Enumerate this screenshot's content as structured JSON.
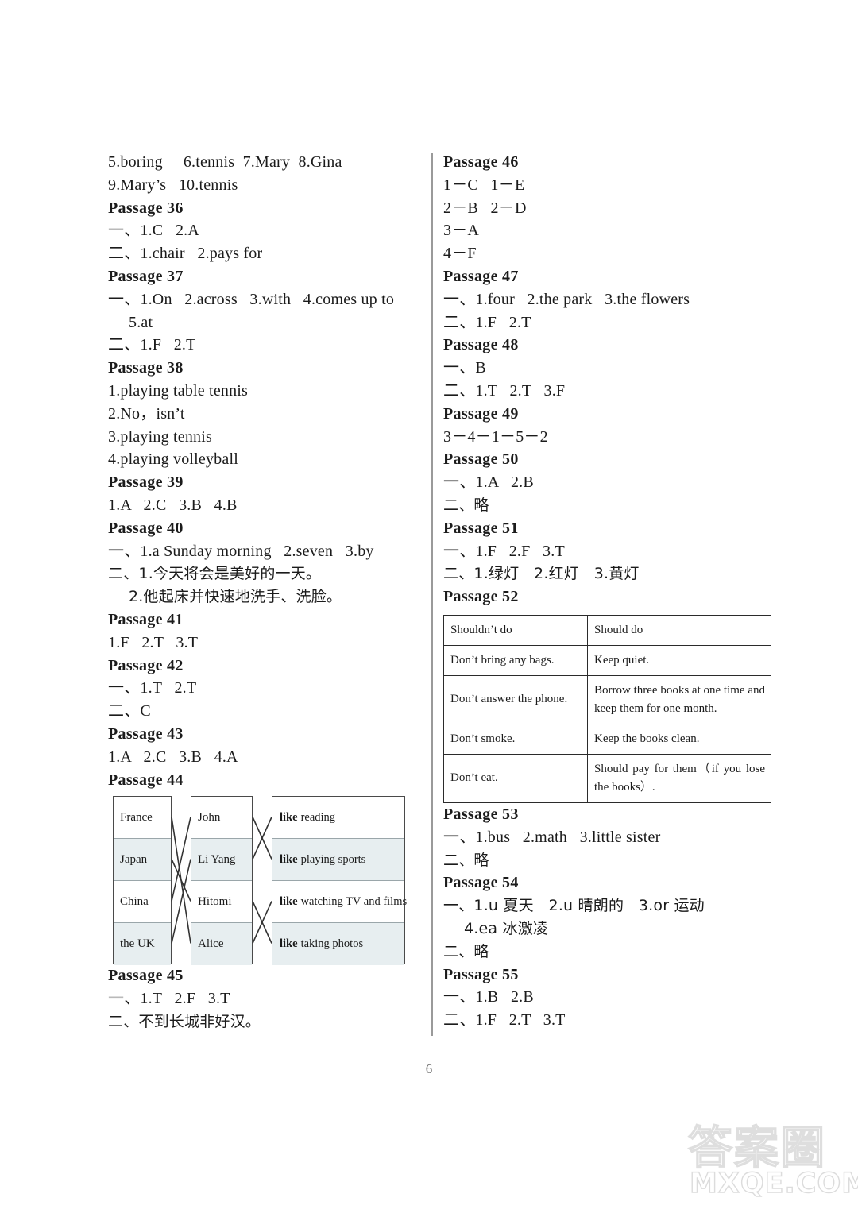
{
  "page": {
    "number": "6"
  },
  "watermark": {
    "cjk": "答案圈",
    "url": "MXQE.COM"
  },
  "left_column": {
    "continued_answers": {
      "line1": "5.boring     6.tennis  7.Mary  8.Gina",
      "line2": "9.Mary’s   10.tennis"
    },
    "passages": [
      {
        "title": "Passage 36",
        "lines": [
          {
            "marker": "一",
            "marker_faded": true,
            "text": "、1.C   2.A"
          },
          {
            "marker": "二",
            "marker_faded": false,
            "text": "、1.chair   2.pays for"
          }
        ]
      },
      {
        "title": "Passage 37",
        "lines": [
          {
            "marker": "一",
            "marker_faded": false,
            "text": "、1.On   2.across   3.with   4.comes up to"
          },
          {
            "marker": "",
            "marker_faded": false,
            "text": "5.at",
            "indent": true
          },
          {
            "marker": "二",
            "marker_faded": false,
            "text": "、1.F   2.T"
          }
        ]
      },
      {
        "title": "Passage 38",
        "lines": [
          {
            "marker": "",
            "marker_faded": false,
            "text": "1.playing table tennis"
          },
          {
            "marker": "",
            "marker_faded": false,
            "text": "2.No，isn’t"
          },
          {
            "marker": "",
            "marker_faded": false,
            "text": "3.playing tennis"
          },
          {
            "marker": "",
            "marker_faded": false,
            "text": "4.playing volleyball"
          }
        ]
      },
      {
        "title": "Passage 39",
        "lines": [
          {
            "marker": "",
            "marker_faded": false,
            "text": "1.A   2.C   3.B   4.B"
          }
        ]
      },
      {
        "title": "Passage 40",
        "lines": [
          {
            "marker": "一",
            "marker_faded": false,
            "text": "、1.a Sunday morning   2.seven   3.by"
          },
          {
            "marker": "二",
            "marker_faded": false,
            "text": "、1.今天将会是美好的一天。",
            "cjk": true
          },
          {
            "marker": "",
            "marker_faded": false,
            "text": "2.他起床并快速地洗手、洗脸。",
            "cjk": true,
            "indent": true
          }
        ]
      },
      {
        "title": "Passage 41",
        "lines": [
          {
            "marker": "",
            "marker_faded": false,
            "text": "1.F   2.T   3.T"
          }
        ]
      },
      {
        "title": "Passage 42",
        "lines": [
          {
            "marker": "一",
            "marker_faded": false,
            "text": "、1.T   2.T"
          },
          {
            "marker": "二",
            "marker_faded": false,
            "text": "、C"
          }
        ]
      },
      {
        "title": "Passage 43",
        "lines": [
          {
            "marker": "",
            "marker_faded": false,
            "text": "1.A   2.C   3.B   4.A"
          }
        ]
      },
      {
        "title": "Passage 44",
        "lines": [],
        "diagram": true
      },
      {
        "title": "Passage 45",
        "lines": [
          {
            "marker": "一",
            "marker_faded": true,
            "text": "、1.T   2.F   3.T"
          },
          {
            "marker": "二",
            "marker_faded": false,
            "text": "、不到长城非好汉。",
            "cjk": true
          }
        ]
      }
    ]
  },
  "matching_diagram": {
    "countries": [
      "France",
      "Japan",
      "China",
      "the UK"
    ],
    "names": [
      "John",
      "Li Yang",
      "Hitomi",
      "Alice"
    ],
    "likes_prefix": "like",
    "likes": [
      "reading",
      "playing sports",
      "watching TV and films",
      "taking photos"
    ],
    "left_links": [
      {
        "from": 0,
        "to": 3
      },
      {
        "from": 1,
        "to": 2
      },
      {
        "from": 2,
        "to": 0
      },
      {
        "from": 3,
        "to": 1
      }
    ],
    "right_links": [
      {
        "from": 0,
        "to": 1
      },
      {
        "from": 1,
        "to": 0
      },
      {
        "from": 2,
        "to": 3
      },
      {
        "from": 3,
        "to": 2
      }
    ]
  },
  "right_column": {
    "passages": [
      {
        "title": "Passage 46",
        "lines": [
          {
            "marker": "",
            "marker_faded": false,
            "text": "1－C   1－E"
          },
          {
            "marker": "",
            "marker_faded": false,
            "text": "2－B   2－D"
          },
          {
            "marker": "",
            "marker_faded": false,
            "text": "3－A"
          },
          {
            "marker": "",
            "marker_faded": false,
            "text": "4－F"
          }
        ]
      },
      {
        "title": "Passage 47",
        "lines": [
          {
            "marker": "一",
            "marker_faded": false,
            "text": "、1.four   2.the park   3.the flowers"
          },
          {
            "marker": "二",
            "marker_faded": false,
            "text": "、1.F   2.T"
          }
        ]
      },
      {
        "title": "Passage 48",
        "lines": [
          {
            "marker": "一",
            "marker_faded": false,
            "text": "、B"
          },
          {
            "marker": "二",
            "marker_faded": false,
            "text": "、1.T   2.T   3.F"
          }
        ]
      },
      {
        "title": "Passage 49",
        "lines": [
          {
            "marker": "",
            "marker_faded": false,
            "text": "3－4－1－5－2"
          }
        ]
      },
      {
        "title": "Passage 50",
        "lines": [
          {
            "marker": "一",
            "marker_faded": false,
            "text": "、1.A   2.B"
          },
          {
            "marker": "二",
            "marker_faded": false,
            "text": "、略",
            "cjk": true
          }
        ]
      },
      {
        "title": "Passage 51",
        "lines": [
          {
            "marker": "一",
            "marker_faded": false,
            "text": "、1.F   2.F   3.T"
          },
          {
            "marker": "二",
            "marker_faded": false,
            "text": "、1.绿灯   2.红灯   3.黄灯",
            "cjk": true
          }
        ]
      },
      {
        "title": "Passage 52",
        "lines": [],
        "table": true
      },
      {
        "title": "Passage 53",
        "lines": [
          {
            "marker": "一",
            "marker_faded": false,
            "text": "、1.bus   2.math   3.little sister"
          },
          {
            "marker": "二",
            "marker_faded": false,
            "text": "、略",
            "cjk": true
          }
        ]
      },
      {
        "title": "Passage 54",
        "lines": [
          {
            "marker": "一",
            "marker_faded": false,
            "text": "、1.u 夏天   2.u 晴朗的   3.or 运动",
            "cjk": true
          },
          {
            "marker": "",
            "marker_faded": false,
            "text": "4.ea 冰激凌",
            "cjk": true,
            "indent": true
          },
          {
            "marker": "二",
            "marker_faded": false,
            "text": "、略",
            "cjk": true
          }
        ]
      },
      {
        "title": "Passage 55",
        "lines": [
          {
            "marker": "一",
            "marker_faded": false,
            "text": "、1.B   2.B"
          },
          {
            "marker": "二",
            "marker_faded": false,
            "text": "、1.F   2.T   3.T"
          }
        ]
      }
    ]
  },
  "should_table": {
    "headers": [
      "Shouldn’t do",
      "Should do"
    ],
    "rows": [
      [
        "Don’t bring any bags.",
        "Keep quiet."
      ],
      [
        "Don’t answer the phone.",
        "Borrow three books at one time and keep them for one month."
      ],
      [
        "Don’t smoke.",
        "Keep the books clean."
      ],
      [
        "Don’t eat.",
        "Should pay for them（if you lose the books）."
      ]
    ]
  }
}
